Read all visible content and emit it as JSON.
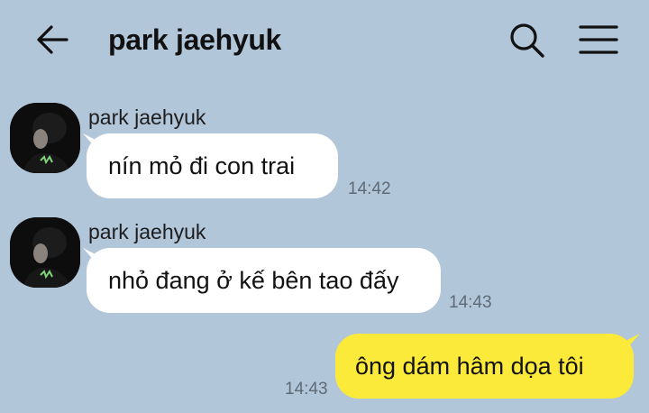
{
  "header": {
    "title": "park jaehyuk",
    "back_icon": "back-arrow-icon",
    "search_icon": "search-icon",
    "menu_icon": "hamburger-menu-icon"
  },
  "colors": {
    "background": "#b2c6da",
    "incoming_bubble": "#ffffff",
    "outgoing_bubble": "#fcea3a"
  },
  "messages": [
    {
      "direction": "incoming",
      "sender": "park jaehyuk",
      "text": "nín mỏ đi con trai",
      "time": "14:42"
    },
    {
      "direction": "incoming",
      "sender": "park jaehyuk",
      "text": "nhỏ đang ở kế bên tao đấy",
      "time": "14:43"
    },
    {
      "direction": "outgoing",
      "text": "ông dám hâm dọa tôi",
      "time": "14:43"
    }
  ]
}
